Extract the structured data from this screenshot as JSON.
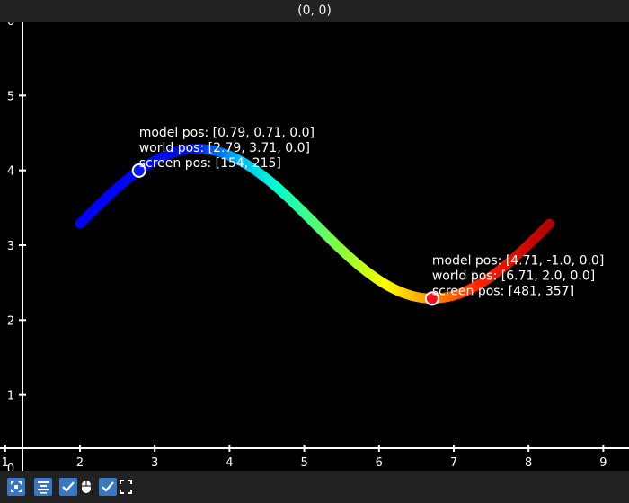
{
  "window": {
    "coordinate_readout": "(0, 0)"
  },
  "toolbar": {
    "icons": [
      "fit-view-icon",
      "align-center-icon",
      "checkbox-icon",
      "mouse-icon",
      "checkbox-icon",
      "fullscreen-icon"
    ]
  },
  "chart_data": {
    "type": "line",
    "xlim": [
      0.75,
      9.3
    ],
    "ylim": [
      0.0,
      6.0
    ],
    "x_ticks": [
      1,
      2,
      3,
      4,
      5,
      6,
      7,
      8,
      9
    ],
    "y_ticks": [
      0,
      1,
      2,
      3,
      4,
      5,
      6
    ],
    "curve": {
      "x_start": 2.0,
      "x_end": 8.28,
      "y_function": "3 + sin(x - 2)",
      "gradient": [
        "#0000ff",
        "#00ffff",
        "#ffff00",
        "#ff8000",
        "#c00000"
      ]
    },
    "markers": [
      {
        "world_x": 2.79,
        "world_y": 3.71,
        "color": "#0a1aff",
        "lines": [
          "model pos: [0.79, 0.71, 0.0]",
          "world pos: [2.79, 3.71, 0.0]",
          "screen pos: [154, 215]"
        ]
      },
      {
        "world_x": 6.71,
        "world_y": 2.0,
        "color": "#ff0a1a",
        "lines": [
          "model pos: [4.71, -1.0, 0.0]",
          "world pos: [6.71, 2.0, 0.0]",
          "screen pos: [481, 357]"
        ]
      }
    ]
  }
}
